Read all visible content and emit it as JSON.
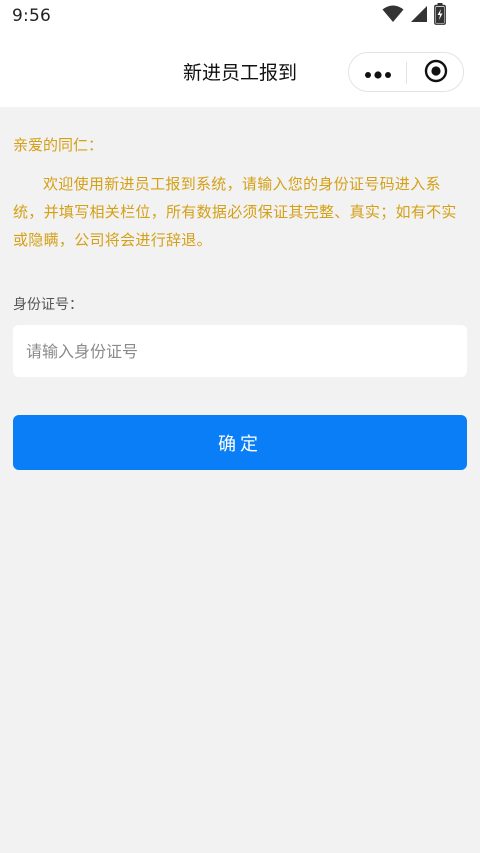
{
  "status_bar": {
    "time": "9:56",
    "icons": [
      "wifi-icon",
      "signal-icon",
      "battery-icon"
    ]
  },
  "nav": {
    "title": "新进员工报到",
    "capsule_icons": [
      "more-icon",
      "close-icon"
    ]
  },
  "notice": {
    "greeting": "亲爱的同仁：",
    "body": "欢迎使用新进员工报到系统，请输入您的身份证号码进入系统，并填写相关栏位，所有数据必须保证其完整、真实；如有不实或隐瞒，公司将会进行辞退。",
    "color": "#d4a017"
  },
  "form": {
    "id_label": "身份证号：",
    "id_value": "",
    "id_placeholder": "请输入身份证号",
    "confirm_label": "确定",
    "accent_color": "#0a7ef7"
  }
}
